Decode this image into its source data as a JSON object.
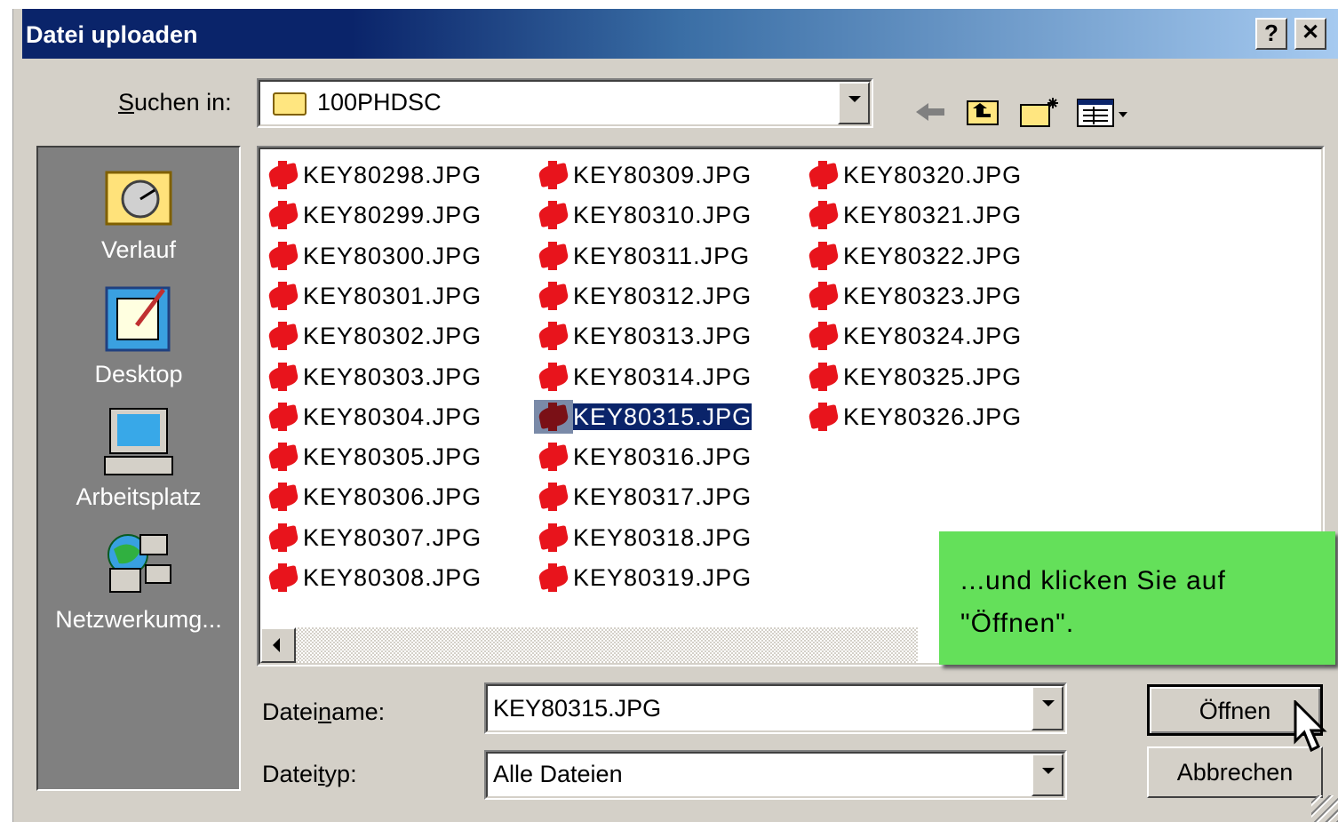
{
  "window": {
    "title": "Datei uploaden",
    "help_label": "?",
    "close_label": "✕"
  },
  "lookin": {
    "label_prefix": "S",
    "label_rest": "uchen in:",
    "value": "100PHDSC"
  },
  "places": [
    {
      "label": "Verlauf",
      "icon": "history-folder-icon"
    },
    {
      "label": "Desktop",
      "icon": "desktop-icon"
    },
    {
      "label": "Arbeitsplatz",
      "icon": "my-computer-icon"
    },
    {
      "label": "Netzwerkumg...",
      "icon": "network-icon"
    }
  ],
  "files": {
    "col1": [
      "KEY80298.JPG",
      "KEY80299.JPG",
      "KEY80300.JPG",
      "KEY80301.JPG",
      "KEY80302.JPG",
      "KEY80303.JPG",
      "KEY80304.JPG",
      "KEY80305.JPG",
      "KEY80306.JPG",
      "KEY80307.JPG",
      "KEY80308.JPG"
    ],
    "col2": [
      "KEY80309.JPG",
      "KEY80310.JPG",
      "KEY80311.JPG",
      "KEY80312.JPG",
      "KEY80313.JPG",
      "KEY80314.JPG",
      "KEY80315.JPG",
      "KEY80316.JPG",
      "KEY80317.JPG",
      "KEY80318.JPG",
      "KEY80319.JPG"
    ],
    "col3": [
      "KEY80320.JPG",
      "KEY80321.JPG",
      "KEY80322.JPG",
      "KEY80323.JPG",
      "KEY80324.JPG",
      "KEY80325.JPG",
      "KEY80326.JPG"
    ],
    "selected": "KEY80315.JPG"
  },
  "filename": {
    "label_pre": "Datei",
    "label_u": "n",
    "label_post": "ame:",
    "value": "KEY80315.JPG"
  },
  "filetype": {
    "label_pre": "Datei",
    "label_u": "t",
    "label_post": "yp:",
    "value": "Alle Dateien"
  },
  "buttons": {
    "open": "Öffnen",
    "cancel": "Abbrechen"
  },
  "callout": {
    "line1": "...und klicken Sie auf",
    "line2": "\"Öffnen\"."
  },
  "colors": {
    "title_start": "#0a246a",
    "title_end": "#a6caf0",
    "callout": "#64e05a",
    "selection": "#0a246a"
  }
}
